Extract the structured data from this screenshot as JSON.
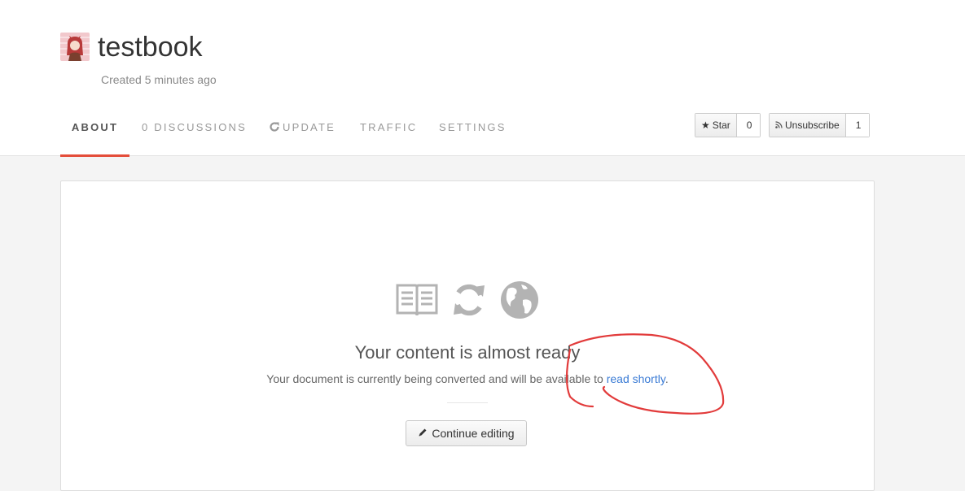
{
  "book": {
    "title": "testbook",
    "created": "Created 5 minutes ago"
  },
  "tabs": [
    {
      "label": "ABOUT",
      "active": true
    },
    {
      "label": "0 DISCUSSIONS",
      "active": false
    },
    {
      "label": "UPDATE",
      "active": false,
      "icon": "refresh-icon"
    },
    {
      "label": "TRAFFIC",
      "active": false
    },
    {
      "label": "SETTINGS",
      "active": false
    }
  ],
  "actions": {
    "star": {
      "label": "Star",
      "count": "0",
      "icon": "star-icon"
    },
    "subscribe": {
      "label": "Unsubscribe",
      "count": "1",
      "icon": "rss-icon"
    }
  },
  "status": {
    "icons": [
      "book-icon",
      "refresh-icon",
      "globe-icon"
    ],
    "heading": "Your content is almost ready",
    "description_prefix": "Your document is currently being converted and will be available to ",
    "link_label": "read shortly",
    "description_suffix": ".",
    "button_label": "Continue editing",
    "button_icon": "pencil-icon"
  },
  "colors": {
    "accent": "#e44d3a",
    "link": "#3a7bd5",
    "annotation": "#e23b3b"
  }
}
